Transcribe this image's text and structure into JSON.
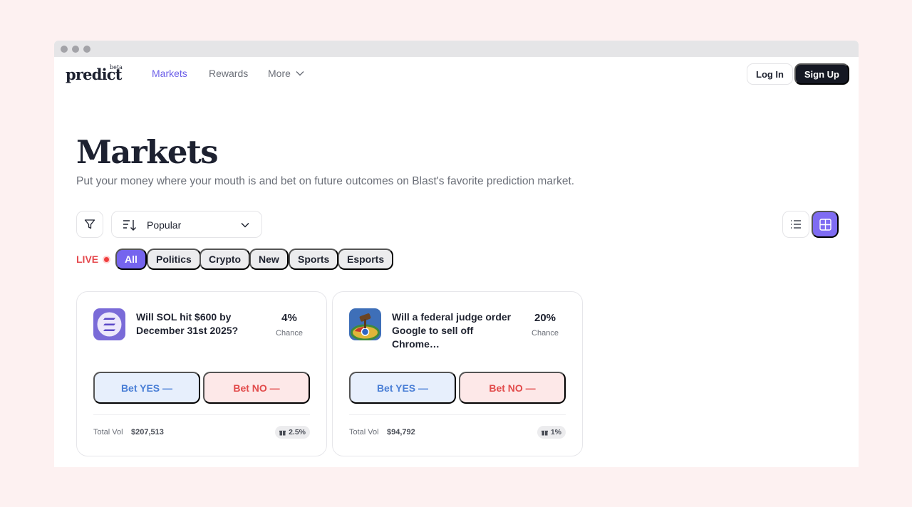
{
  "brand": {
    "logo": "predict",
    "badge": "beta"
  },
  "nav": {
    "links": [
      "Markets",
      "Rewards",
      "More"
    ],
    "login": "Log In",
    "signup": "Sign Up"
  },
  "header": {
    "title": "Markets",
    "subtitle": "Put your money where your mouth is and bet on future outcomes on Blast's favorite prediction market."
  },
  "toolbar": {
    "sort_value": "Popular",
    "filter_icon": "filter-icon",
    "list_view_icon": "list-icon",
    "grid_view_icon": "grid-icon"
  },
  "categories": {
    "live_label": "LIVE",
    "chips": [
      "All",
      "Politics",
      "Crypto",
      "New",
      "Sports",
      "Esports"
    ],
    "active": "All"
  },
  "markets": [
    {
      "question": "Will SOL hit $600 by December 31st 2025?",
      "percent": "4%",
      "chance_label": "Chance",
      "yes_label": "Bet YES —",
      "no_label": "Bet NO —",
      "vol_label": "Total Vol",
      "vol_value": "$207,513",
      "fee": "2.5%"
    },
    {
      "question": "Will a federal judge order Google to sell off Chrome…",
      "percent": "20%",
      "chance_label": "Chance",
      "yes_label": "Bet YES —",
      "no_label": "Bet NO —",
      "vol_label": "Total Vol",
      "vol_value": "$94,792",
      "fee": "1%"
    }
  ],
  "colors": {
    "accent": "#7564ee",
    "yes_bg": "#e7effc",
    "yes_text": "#4a7fd6",
    "no_bg": "#fde8e8",
    "no_text": "#e24b4b",
    "live": "#e5484d"
  }
}
